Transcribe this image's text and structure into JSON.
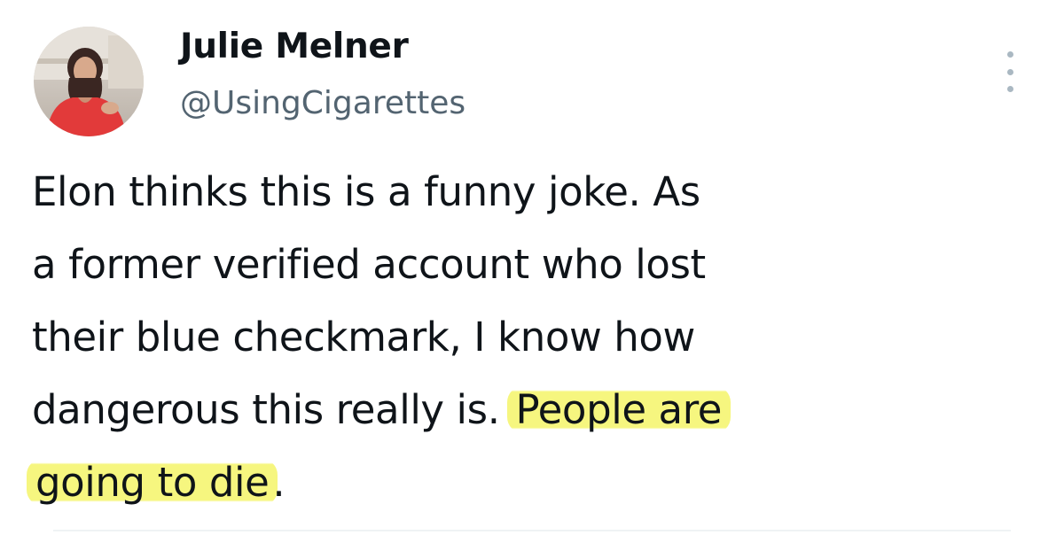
{
  "author": {
    "display_name": "Julie Melner",
    "handle": "@UsingCigarettes"
  },
  "icons": {
    "more": "more-dots-icon",
    "avatar": "profile-photo"
  },
  "tweet": {
    "lines": [
      {
        "text": "Elon thinks this is a funny joke. As",
        "highlight": ""
      },
      {
        "text": "a former verified account who lost",
        "highlight": ""
      },
      {
        "text": "their blue checkmark, I know how",
        "highlight": ""
      },
      {
        "text": "dangerous this really is. ",
        "highlight": "People are"
      },
      {
        "text": "",
        "highlight": "going to die",
        "after": "."
      }
    ]
  },
  "colors": {
    "text": "#0f1419",
    "secondary": "#536471",
    "highlight": "#f6f678"
  }
}
